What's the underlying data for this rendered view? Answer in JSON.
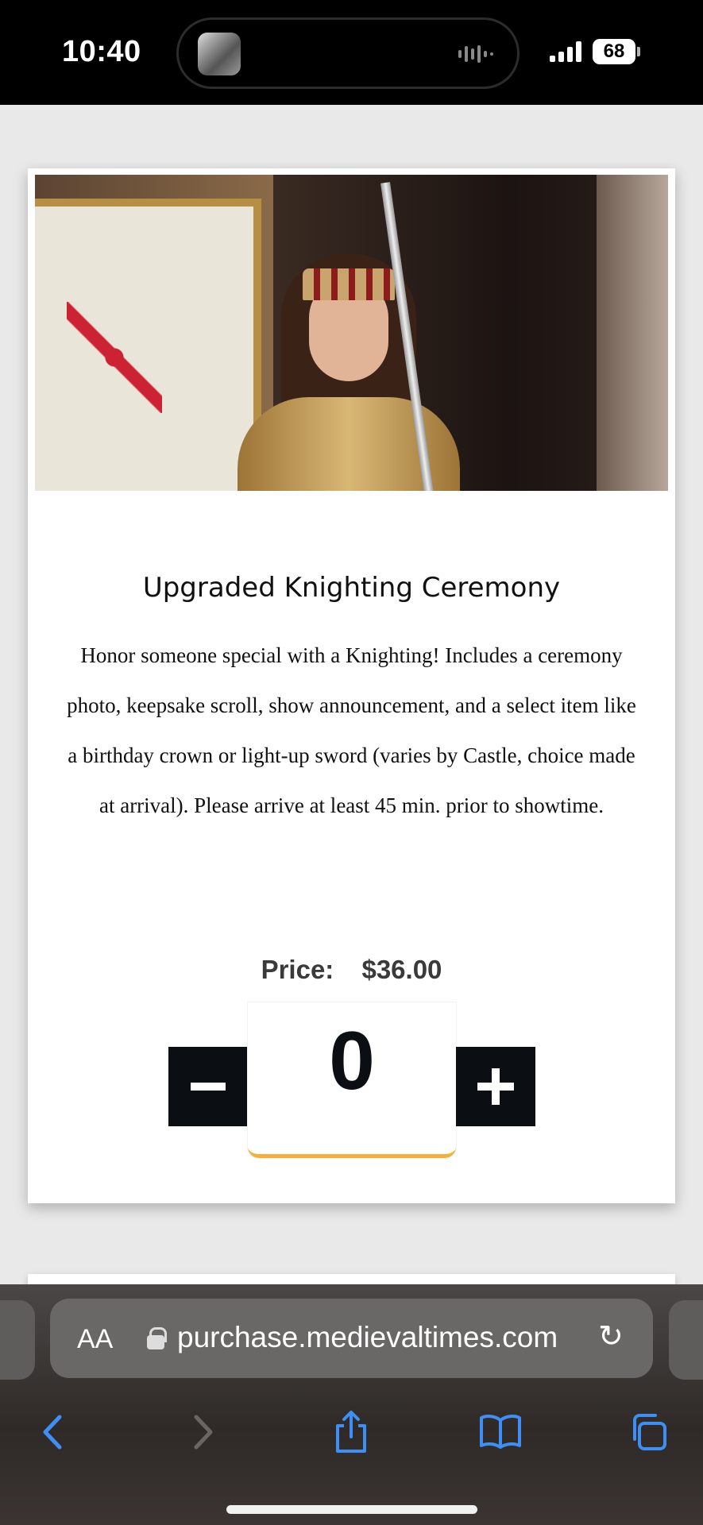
{
  "status_bar": {
    "time": "10:40",
    "battery": "68"
  },
  "product": {
    "title": "Upgraded Knighting Ceremony",
    "description": "Honor someone special with a Knighting! Includes a ceremony photo, keepsake scroll, show announcement, and a select item like a birthday crown or light-up sword (varies by Castle, choice made at arrival). Please arrive at least 45 min. prior to showtime.",
    "price_label": "Price:",
    "price_value": "$36.00",
    "quantity": "0",
    "minus_icon": "minus-icon",
    "plus_icon": "plus-icon"
  },
  "browser": {
    "aa_label": "AA",
    "url": "purchase.medievaltimes.com",
    "icons": [
      "back-icon",
      "forward-icon",
      "share-icon",
      "bookmarks-icon",
      "tabs-icon",
      "reload-icon",
      "lock-icon"
    ]
  },
  "colors": {
    "accent_underline": "#f3b13a",
    "button_bg": "#0b0f14",
    "safari_blue": "#3d8ff5"
  }
}
